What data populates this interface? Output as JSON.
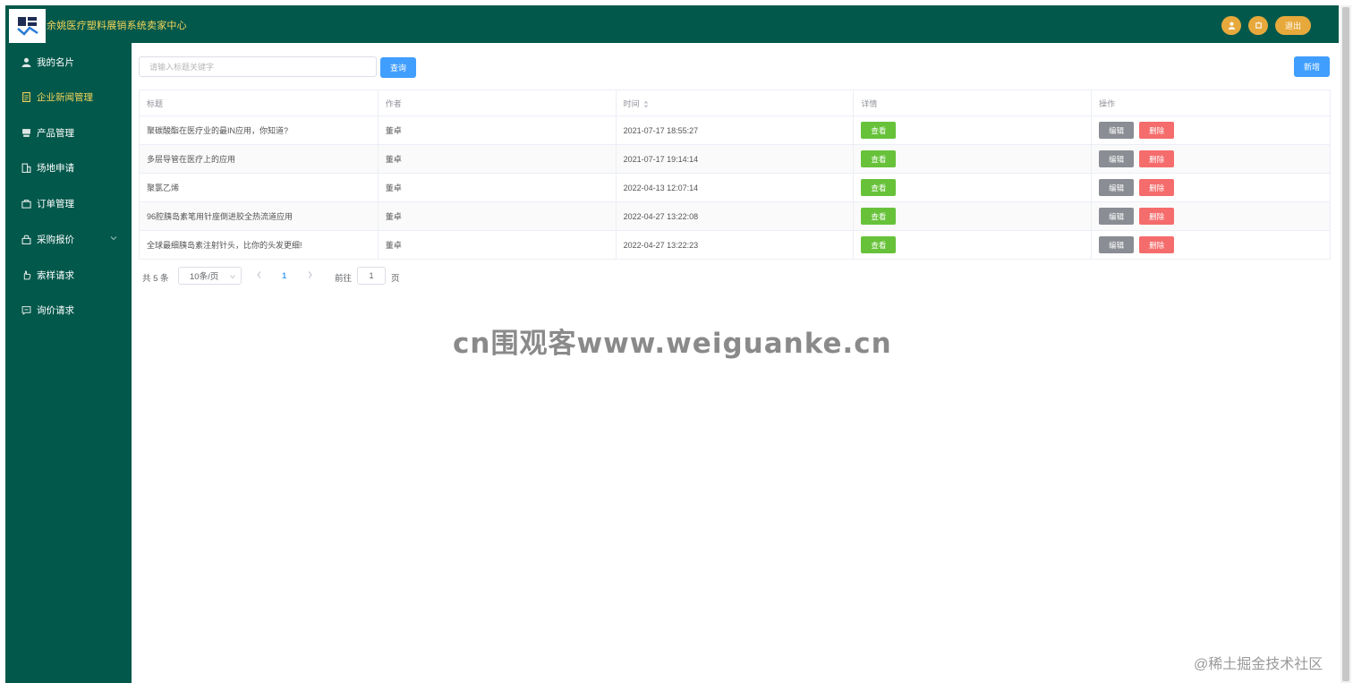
{
  "app": {
    "title": "余姚医疗塑料展销系统卖家中心",
    "logout_label": "退出"
  },
  "sidebar": {
    "items": [
      {
        "label": "我的名片",
        "icon": "user-icon"
      },
      {
        "label": "企业新闻管理",
        "icon": "document-icon",
        "active": true
      },
      {
        "label": "产品管理",
        "icon": "product-icon"
      },
      {
        "label": "场地申请",
        "icon": "building-icon"
      },
      {
        "label": "订单管理",
        "icon": "bag-icon"
      },
      {
        "label": "采购报价",
        "icon": "lock-bag-icon",
        "expandable": true
      },
      {
        "label": "索样请求",
        "icon": "hand-icon"
      },
      {
        "label": "询价请求",
        "icon": "chat-icon"
      }
    ]
  },
  "toolbar": {
    "search_placeholder": "请输入标题关键字",
    "search_label": "查询",
    "add_label": "新增"
  },
  "table": {
    "headers": [
      "标题",
      "作者",
      "时间",
      "详情",
      "操作"
    ],
    "view_label": "查看",
    "edit_label": "编辑",
    "delete_label": "删除",
    "rows": [
      {
        "title": "聚碳酸酯在医疗业的最IN应用，你知道?",
        "author": "董卓",
        "time": "2021-07-17 18:55:27"
      },
      {
        "title": "多层导管在医疗上的应用",
        "author": "董卓",
        "time": "2021-07-17 19:14:14"
      },
      {
        "title": "聚氯乙烯",
        "author": "董卓",
        "time": "2022-04-13 12:07:14"
      },
      {
        "title": "96腔胰岛素笔用针座倒进胶全热流道应用",
        "author": "董卓",
        "time": "2022-04-27 13:22:08"
      },
      {
        "title": "全球最细胰岛素注射针头，比你的头发更细!",
        "author": "董卓",
        "time": "2022-04-27 13:22:23"
      }
    ]
  },
  "pagination": {
    "total": "共 5 条",
    "page_size": "10条/页",
    "current_page": "1",
    "goto_label": "前往",
    "goto_value": "1",
    "page_suffix": "页"
  },
  "watermark": "cn围观客www.weiguanke.cn",
  "corner_watermark": "@稀土掘金技术社区",
  "colors": {
    "brand": "#02584b",
    "accent": "#f5d55a",
    "orange": "#e7a93c",
    "primary": "#409eff",
    "success": "#67c23a",
    "danger": "#f56c6c"
  }
}
